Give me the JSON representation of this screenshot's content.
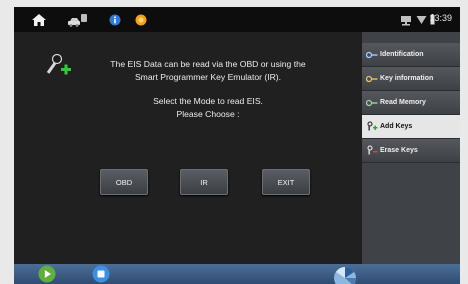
{
  "status_bar": {
    "time": "13:39"
  },
  "dialog": {
    "line1": "The EIS Data can be read via the OBD or using the",
    "line2": "Smart Programmer Key Emulator (IR).",
    "line3": "Select the Mode to read EIS.",
    "line4": "Please Choose :"
  },
  "buttons": {
    "obd": "OBD",
    "ir": "IR",
    "exit": "EXIT"
  },
  "sidebar": {
    "items": [
      {
        "label": "Identification"
      },
      {
        "label": "Key information"
      },
      {
        "label": "Read Memory"
      },
      {
        "label": "Add Keys"
      },
      {
        "label": "Erase Keys"
      }
    ]
  },
  "colors": {
    "accent_green": "#3cc43c",
    "accent_blue": "#2f79d8",
    "bottom_bar": "#3b5c85"
  }
}
